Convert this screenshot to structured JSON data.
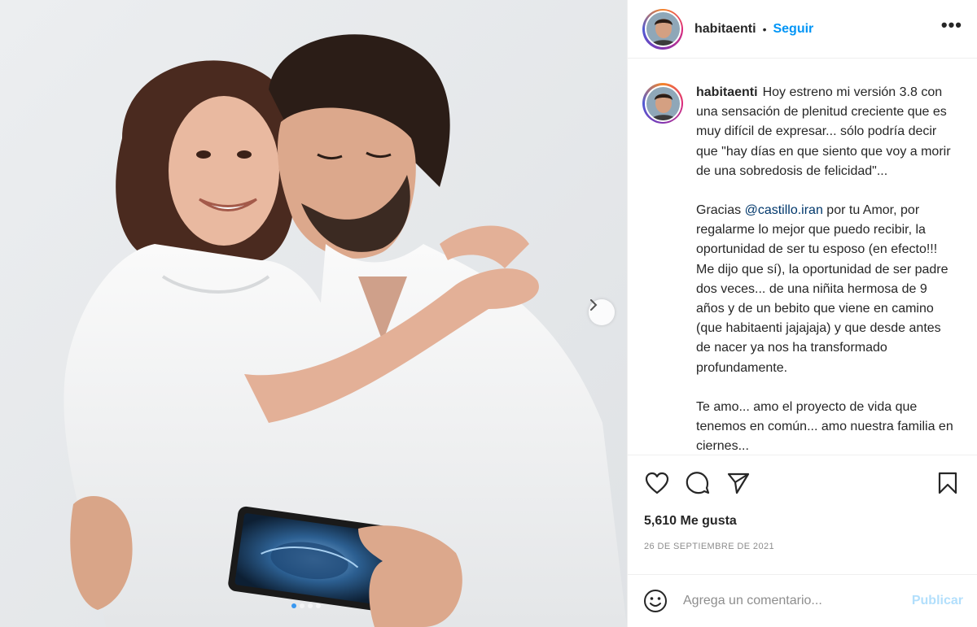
{
  "post": {
    "username": "habitaenti",
    "separator": "•",
    "follow_label": "Seguir",
    "more_label": "•••"
  },
  "caption": {
    "username": "habitaenti",
    "p1": "Hoy estreno mi versión 3.8 con una sensación de plenitud creciente que es muy difícil de expresar... sólo podría decir que \"hay días en que siento que voy a morir de una sobredosis de felicidad\"...",
    "p2_before": "Gracias ",
    "p2_mention": "@castillo.iran",
    "p2_after": " por tu Amor, por regalarme lo mejor que puedo recibir, la oportunidad de ser tu esposo (en efecto!!! Me dijo que sí), la oportunidad de ser padre dos veces... de una niñita hermosa de 9 años y de un bebito que viene en camino (que habitaenti jajajaja) y que desde antes de nacer ya nos ha transformado profundamente.",
    "p3": "Te amo... amo el proyecto de vida que tenemos en común... amo nuestra familia en ciernes..."
  },
  "stats": {
    "likes": "5,610 Me gusta",
    "date": "26 DE SEPTIEMBRE DE 2021"
  },
  "comment": {
    "placeholder": "Agrega un comentario...",
    "publish_label": "Publicar"
  },
  "icons": {
    "like": "heart-icon",
    "comment": "comment-bubble-icon",
    "share": "paper-plane-icon",
    "save": "bookmark-icon",
    "emoji": "smiley-icon",
    "next": "chevron-right-icon"
  },
  "carousel": {
    "slide_count": 4,
    "active_index": 0
  },
  "colors": {
    "follow": "#0095f6",
    "mention": "#00376b",
    "publish_disabled": "#b2dffc",
    "muted": "#8e8e8e"
  }
}
